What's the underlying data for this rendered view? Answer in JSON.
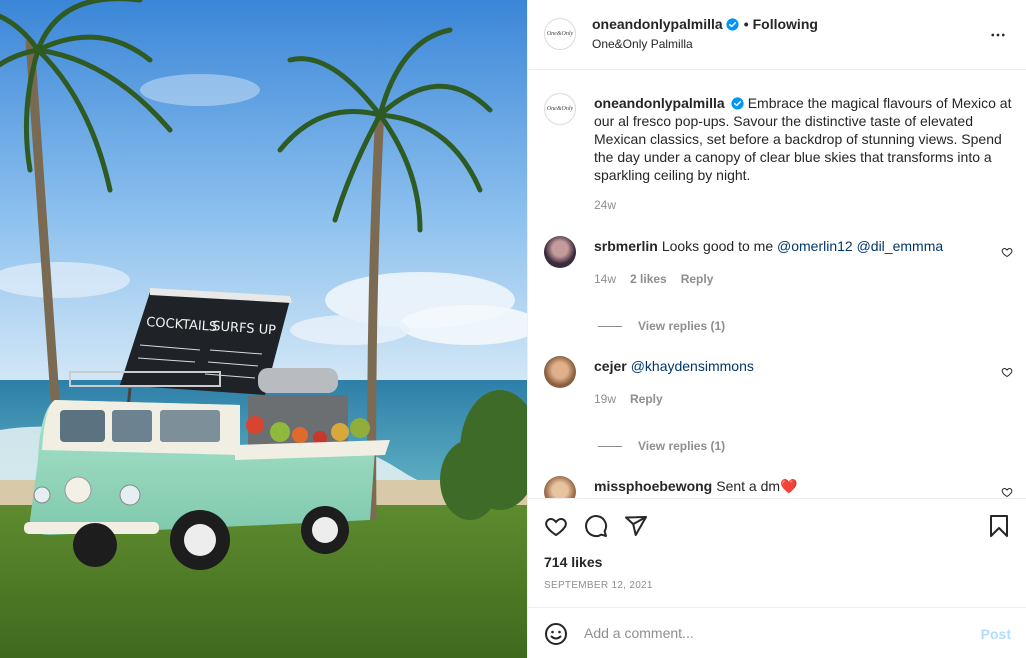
{
  "photo": {
    "board_text_left": "COCKTAILS",
    "board_text_right": "SURFS UP"
  },
  "header": {
    "logo_text": "One&Only",
    "username": "oneandonlypalmilla",
    "separator": "•",
    "follow_label": "Following",
    "subname": "One&Only Palmilla",
    "more_icon": "more-horizontal-icon"
  },
  "caption": {
    "username": "oneandonlypalmilla",
    "text": "Embrace the magical flavours of Mexico at our al fresco pop-ups. Savour the distinctive taste of elevated Mexican classics, set before a backdrop of stunning views. Spend the day under a canopy of clear blue skies that transforms into a sparkling ceiling by night.",
    "time": "24w"
  },
  "comments": [
    {
      "username": "srbmerlin",
      "text": "Looks good to me ",
      "mentions": "@omerlin12 @dil_emmma",
      "time": "14w",
      "likes": "2 likes",
      "reply": "Reply",
      "view_replies": "View replies (1)"
    },
    {
      "username": "cejer",
      "text": "",
      "mentions": "@khaydensimmons",
      "time": "19w",
      "reply": "Reply",
      "view_replies": "View replies (1)"
    },
    {
      "username": "missphoebewong",
      "text": "Sent a dm❤️"
    }
  ],
  "actions": {
    "likes": "714 likes",
    "date": "SEPTEMBER 12, 2021"
  },
  "add_comment": {
    "placeholder": "Add a comment...",
    "post_label": "Post"
  },
  "colors": {
    "verified": "#0095f6",
    "mention": "#00376b",
    "post_disabled": "#b3dbff",
    "secondary_text": "#8e8e8e"
  }
}
